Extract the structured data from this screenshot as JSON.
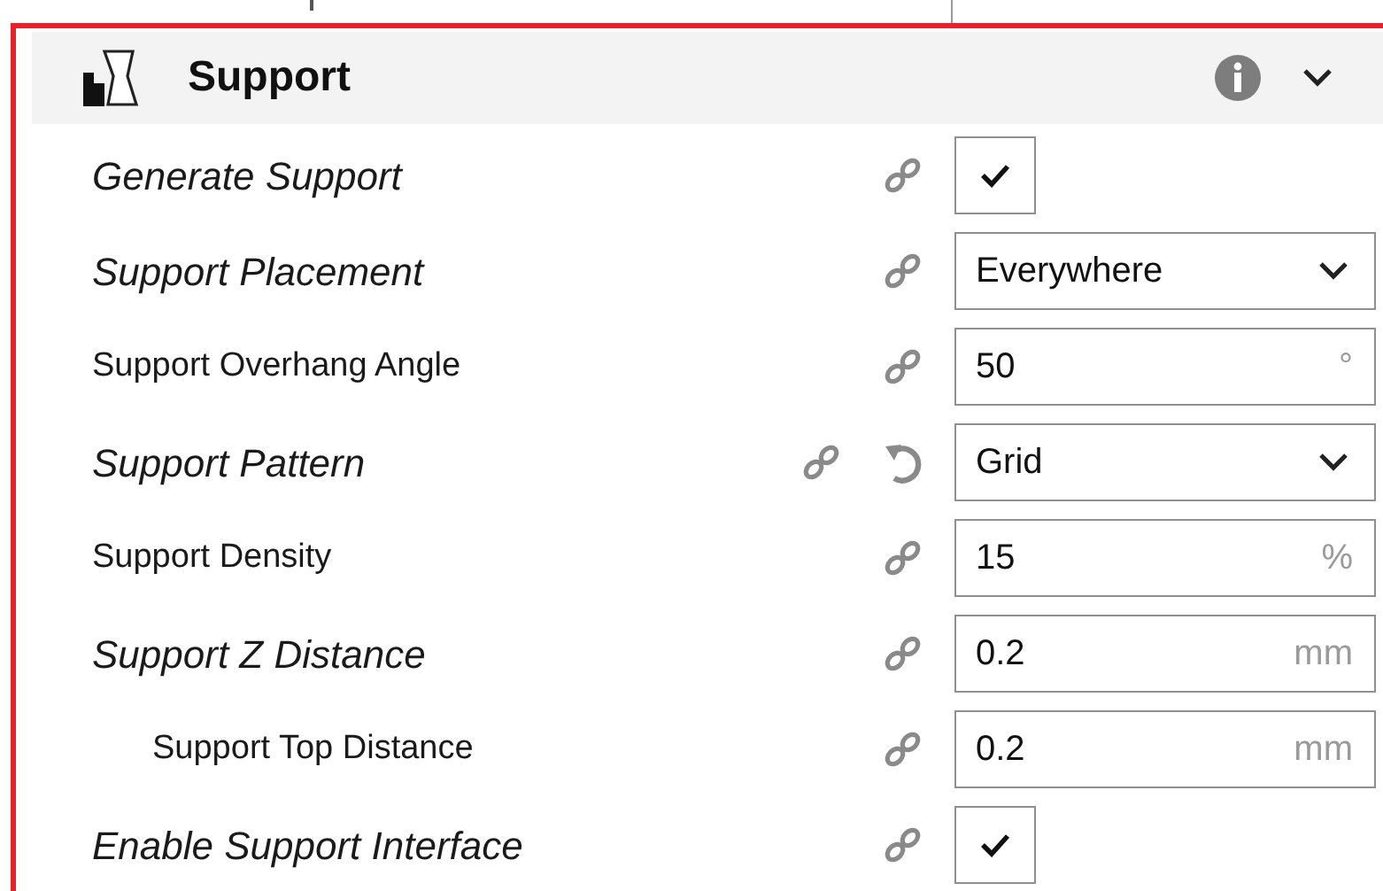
{
  "section": {
    "title": "Support",
    "expanded": true
  },
  "settings": [
    {
      "label": "Generate Support",
      "kind": "checkbox",
      "overridden": true,
      "checked": true,
      "resettable": false
    },
    {
      "label": "Support Placement",
      "kind": "dropdown",
      "overridden": true,
      "value": "Everywhere",
      "resettable": false
    },
    {
      "label": "Support Overhang Angle",
      "kind": "number",
      "overridden": false,
      "value": "50",
      "unit": "°",
      "resettable": false
    },
    {
      "label": "Support Pattern",
      "kind": "dropdown",
      "overridden": true,
      "value": "Grid",
      "resettable": true
    },
    {
      "label": "Support Density",
      "kind": "number",
      "overridden": false,
      "value": "15",
      "unit": "%",
      "resettable": false
    },
    {
      "label": "Support Z Distance",
      "kind": "number",
      "overridden": true,
      "value": "0.2",
      "unit": "mm",
      "resettable": false,
      "children": [
        {
          "label": "Support Top Distance",
          "kind": "number",
          "overridden": false,
          "value": "0.2",
          "unit": "mm",
          "resettable": false
        }
      ]
    },
    {
      "label": "Enable Support Interface",
      "kind": "checkbox",
      "overridden": true,
      "checked": true,
      "resettable": false
    }
  ]
}
